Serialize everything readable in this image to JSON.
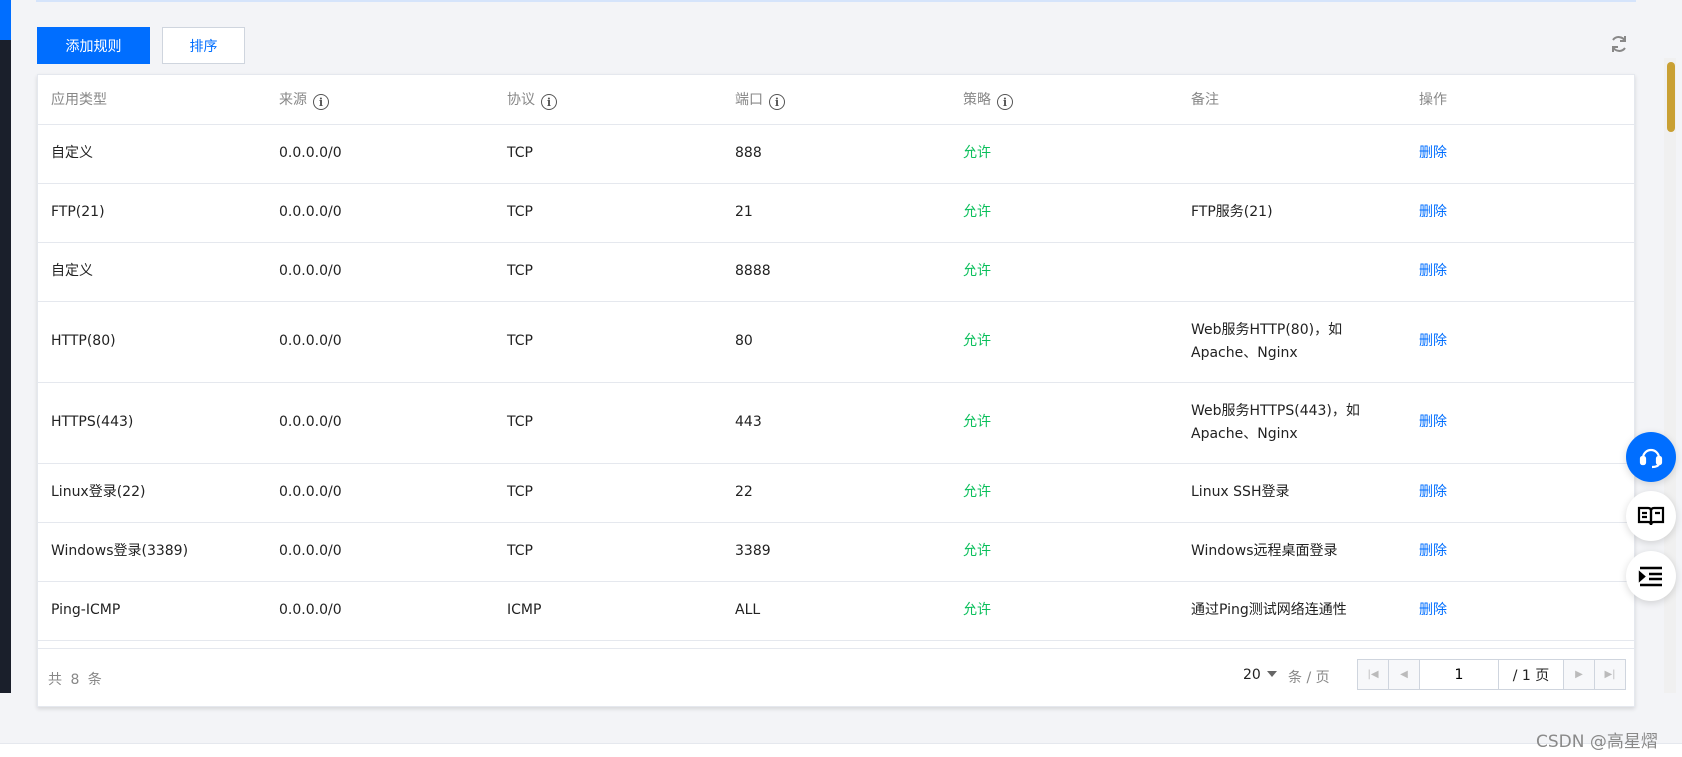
{
  "toolbar": {
    "add_rule_label": "添加规则",
    "sort_label": "排序"
  },
  "table": {
    "headers": [
      {
        "label": "应用类型",
        "info": false
      },
      {
        "label": "来源",
        "info": true
      },
      {
        "label": "协议",
        "info": true
      },
      {
        "label": "端口",
        "info": true
      },
      {
        "label": "策略",
        "info": true
      },
      {
        "label": "备注",
        "info": false
      },
      {
        "label": "操作",
        "info": false
      }
    ],
    "rows": [
      {
        "app": "自定义",
        "source": "0.0.0.0/0",
        "protocol": "TCP",
        "port": "888",
        "policy": "允许",
        "note": "",
        "action": "删除"
      },
      {
        "app": "FTP(21)",
        "source": "0.0.0.0/0",
        "protocol": "TCP",
        "port": "21",
        "policy": "允许",
        "note": "FTP服务(21)",
        "action": "删除"
      },
      {
        "app": "自定义",
        "source": "0.0.0.0/0",
        "protocol": "TCP",
        "port": "8888",
        "policy": "允许",
        "note": "",
        "action": "删除"
      },
      {
        "app": "HTTP(80)",
        "source": "0.0.0.0/0",
        "protocol": "TCP",
        "port": "80",
        "policy": "允许",
        "note": "Web服务HTTP(80)，如Apache、Nginx",
        "action": "删除"
      },
      {
        "app": "HTTPS(443)",
        "source": "0.0.0.0/0",
        "protocol": "TCP",
        "port": "443",
        "policy": "允许",
        "note": "Web服务HTTPS(443)，如Apache、Nginx",
        "action": "删除"
      },
      {
        "app": "Linux登录(22)",
        "source": "0.0.0.0/0",
        "protocol": "TCP",
        "port": "22",
        "policy": "允许",
        "note": "Linux SSH登录",
        "action": "删除"
      },
      {
        "app": "Windows登录(3389)",
        "source": "0.0.0.0/0",
        "protocol": "TCP",
        "port": "3389",
        "policy": "允许",
        "note": "Windows远程桌面登录",
        "action": "删除"
      },
      {
        "app": "Ping-ICMP",
        "source": "0.0.0.0/0",
        "protocol": "ICMP",
        "port": "ALL",
        "policy": "允许",
        "note": "通过Ping测试网络连通性",
        "action": "删除"
      }
    ]
  },
  "footer": {
    "total_text": "共 8 条",
    "page_size": "20",
    "per_page_text": "条 / 页",
    "current_page": "1",
    "total_pages_text": "/ 1 页"
  },
  "icons": {
    "refresh": "refresh-icon",
    "info": "info-icon",
    "support": "headset-icon",
    "docs": "book-icon",
    "menu": "list-indent-icon"
  },
  "colors": {
    "primary": "#006eff",
    "allow": "#0abf5b"
  },
  "watermark": "CSDN @高星熠"
}
